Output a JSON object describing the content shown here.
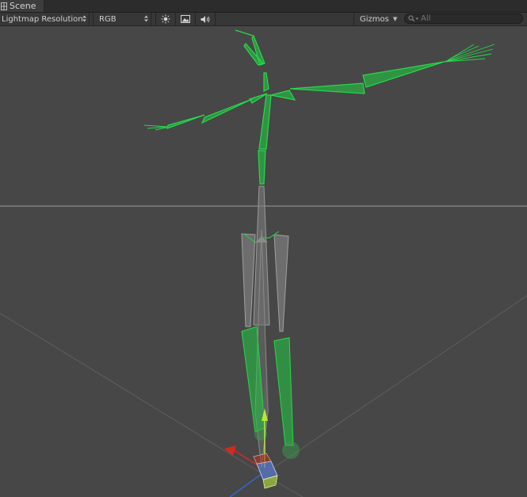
{
  "tabs": [
    {
      "label": "Scene",
      "icon": "scene-grid-icon"
    }
  ],
  "toolbar": {
    "render_mode": "Lightmap Resolution",
    "color_mode": "RGB",
    "lighting_toggle_icon": "sun-icon",
    "image_toggle_icon": "image-icon",
    "audio_toggle_icon": "speaker-icon",
    "gizmos_label": "Gizmos",
    "search_placeholder": "All"
  },
  "colors": {
    "background": "#474747",
    "tabbar": "#2c2c2c",
    "toolbar": "#373737",
    "bone_selected": "#22c843",
    "bone_unselected": "#7a7a7a",
    "horizon": "#8a8a8a",
    "axis_x": "#d22a1e",
    "axis_y": "#b8e83a",
    "axis_z": "#3366cc"
  }
}
